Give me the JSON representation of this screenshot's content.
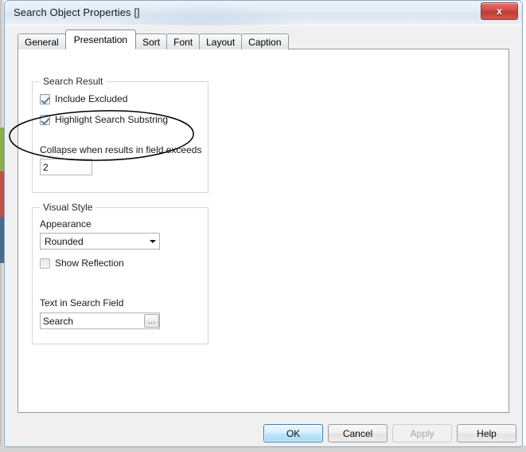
{
  "window": {
    "title": "Search Object Properties []",
    "close_label": "x",
    "close_icon": "close-icon"
  },
  "tabs": [
    {
      "label": "General",
      "active": false
    },
    {
      "label": "Presentation",
      "active": true
    },
    {
      "label": "Sort",
      "active": false
    },
    {
      "label": "Font",
      "active": false
    },
    {
      "label": "Layout",
      "active": false
    },
    {
      "label": "Caption",
      "active": false
    }
  ],
  "search_result_group": {
    "title": "Search Result",
    "include_excluded": {
      "label": "Include Excluded",
      "checked": true
    },
    "highlight_substring": {
      "label": "Highlight Search Substring",
      "checked": true
    },
    "collapse": {
      "label": "Collapse when results in field exceeds",
      "value": "2",
      "placeholder": ""
    }
  },
  "visual_style_group": {
    "title": "Visual Style",
    "appearance": {
      "label": "Appearance",
      "value": "Rounded",
      "options": [
        "Rounded"
      ],
      "arrow_icon": "chevron-down-icon"
    },
    "show_reflection": {
      "label": "Show Reflection",
      "checked": false
    },
    "text_in_search_field": {
      "label": "Text in Search Field",
      "value": "Search",
      "placeholder": "",
      "browse_label": "...",
      "browse_icon": "ellipsis-icon"
    }
  },
  "footer": {
    "ok": "OK",
    "cancel": "Cancel",
    "apply": "Apply",
    "help": "Help"
  },
  "annotation": {
    "shape": "ellipse",
    "color": "#000000",
    "target": "Collapse when results in field exceeds"
  },
  "colors": {
    "accent": "#3c7fb1",
    "close_button": "#cf4c44",
    "checkmark": "#5a7a93",
    "bg_strip_green": "#87a844",
    "bg_strip_red": "#bb4f44",
    "bg_strip_blue": "#44688a"
  }
}
